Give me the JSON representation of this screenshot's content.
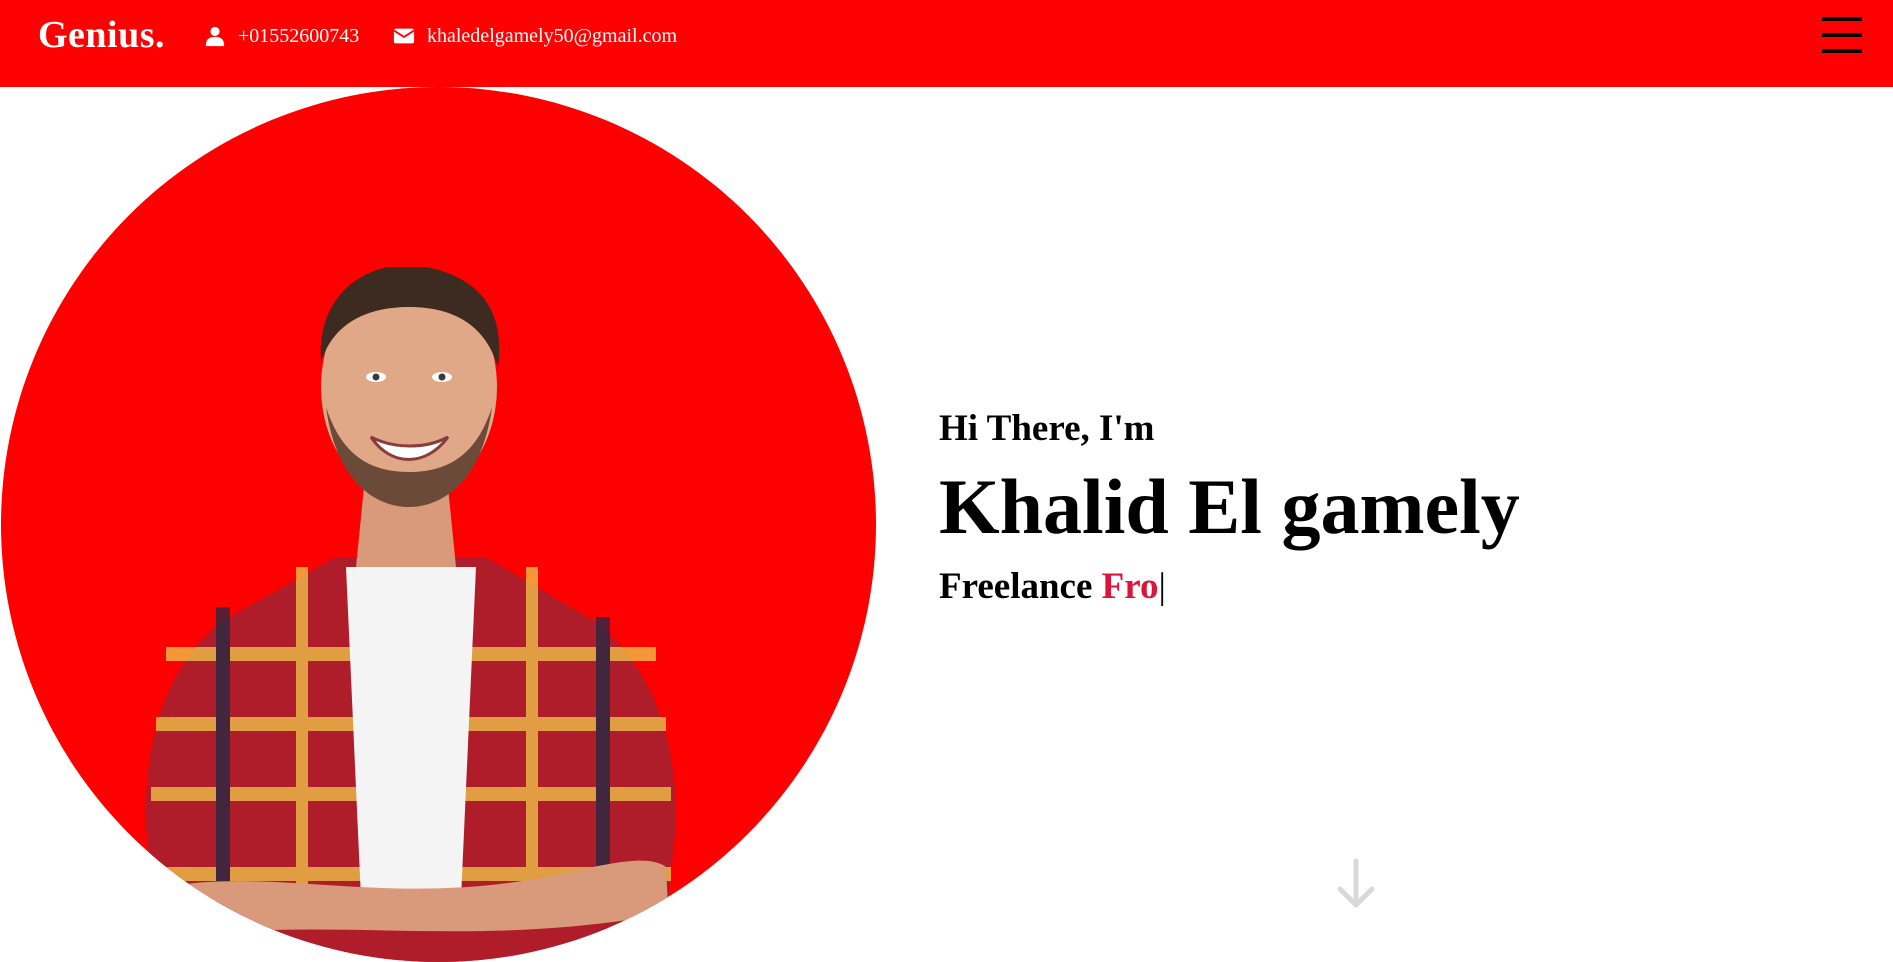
{
  "header": {
    "logo": "Genius.",
    "phone": "+01552600743",
    "email": "khaledelgamely50@gmail.com",
    "phone_icon": "user-icon",
    "email_icon": "envelope-icon",
    "menu_icon": "hamburger-menu-icon"
  },
  "hero": {
    "greeting": "Hi There, I'm",
    "name": "Khalid El gamely",
    "role_prefix": "Freelance",
    "role_typed": "Fro",
    "caret": "|",
    "scroll_icon": "arrow-down-icon"
  },
  "colors": {
    "accent": "#ff0000",
    "typed_text": "#dc143c",
    "text": "#000000",
    "header_text": "#ffffff",
    "scroll_icon": "#d9d9d9"
  }
}
